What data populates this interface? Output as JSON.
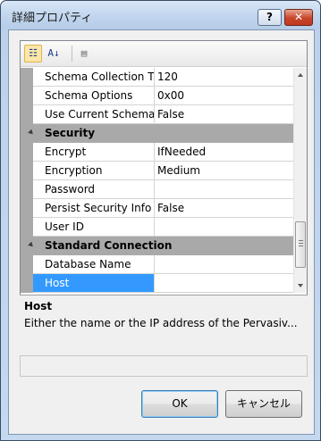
{
  "window": {
    "title": "詳細プロパティ",
    "help_label": "?",
    "close_label": "✕"
  },
  "toolbar": {
    "categorized_label": "☷",
    "alphabetical_label": "A↓",
    "pages_label": "▤"
  },
  "rows": [
    {
      "type": "prop",
      "name": "Schema Collection Ti",
      "value": "120"
    },
    {
      "type": "prop",
      "name": "Schema Options",
      "value": "0x00"
    },
    {
      "type": "prop",
      "name": "Use Current Schema",
      "value": "False"
    },
    {
      "type": "category",
      "name": "Security"
    },
    {
      "type": "prop",
      "name": "Encrypt",
      "value": "IfNeeded"
    },
    {
      "type": "prop",
      "name": "Encryption",
      "value": "Medium"
    },
    {
      "type": "prop",
      "name": "Password",
      "value": ""
    },
    {
      "type": "prop",
      "name": "Persist Security Info",
      "value": "False"
    },
    {
      "type": "prop",
      "name": "User ID",
      "value": ""
    },
    {
      "type": "category",
      "name": "Standard Connection"
    },
    {
      "type": "prop",
      "name": "Database Name",
      "value": ""
    },
    {
      "type": "prop",
      "name": "Host",
      "value": "",
      "selected": true
    }
  ],
  "description": {
    "title": "Host",
    "text": "Either the name or the IP address of the Pervasiv..."
  },
  "buttons": {
    "ok": "OK",
    "cancel": "キャンセル"
  },
  "colors": {
    "selection": "#3399ff",
    "category_bg": "#a9a9a9"
  }
}
